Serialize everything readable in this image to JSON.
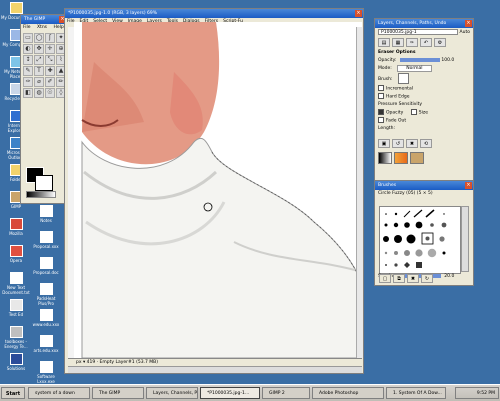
{
  "desktop": {
    "icons_left": [
      {
        "label": "My Documents",
        "icon": "folder-docs-icon"
      },
      {
        "label": "My Computer",
        "icon": "computer-icon"
      },
      {
        "label": "My Network Places",
        "icon": "network-icon"
      },
      {
        "label": "Recycle Bin",
        "icon": "recycle-bin-icon"
      },
      {
        "label": "Internet Explorer",
        "icon": "ie-icon"
      },
      {
        "label": "Microsoft Outlook",
        "icon": "outlook-icon"
      },
      {
        "label": "Folder",
        "icon": "folder-icon"
      },
      {
        "label": "GIMP",
        "icon": "gimp-icon"
      },
      {
        "label": "Mozilla",
        "icon": "mozilla-icon"
      },
      {
        "label": "Opera",
        "icon": "opera-icon"
      },
      {
        "label": "New Text Document.txt",
        "icon": "text-doc-icon"
      },
      {
        "label": "Test Ed",
        "icon": "app-icon"
      },
      {
        "label": "toolboxes - Energy Te...",
        "icon": "app-icon"
      },
      {
        "label": "Solutions",
        "icon": "solutions-icon"
      }
    ],
    "icons_right": [
      {
        "label": "Notes",
        "icon": "doc-icon"
      },
      {
        "label": "Proposal.xxx",
        "icon": "doc-icon"
      },
      {
        "label": "Proposal.doc",
        "icon": "doc-icon"
      },
      {
        "label": "PadsHeat Plus/Pro",
        "icon": "doc-icon"
      },
      {
        "label": "www.edu.xxx",
        "icon": "doc-icon"
      },
      {
        "label": "arts.edu.xxx",
        "icon": "doc-icon"
      },
      {
        "label": "Software Lxxx.exe",
        "icon": "doc-icon"
      }
    ]
  },
  "toolbox": {
    "title": "The GIMP",
    "menu": [
      "File",
      "Xtns",
      "Help"
    ],
    "tools": [
      "▭",
      "◯",
      "ʃ",
      "✦",
      "◐",
      "✥",
      "✛",
      "⊕",
      "↕",
      "⤢",
      "⤡",
      "⌇",
      "✎",
      "T",
      "✚",
      "▲",
      "✑",
      "⌀",
      "✐",
      "✏",
      "◧",
      "◍",
      "☉",
      "◊"
    ]
  },
  "image_window": {
    "title": "*P1000035.jpg-1.0 (RGB, 3 layers) 69%",
    "menu": [
      "File",
      "Edit",
      "Select",
      "View",
      "Image",
      "Layers",
      "Tools",
      "Dialogs",
      "Filters",
      "Script-Fu"
    ],
    "status": "px ▾ 419 · Empty Layer#1 (53.7 MB)",
    "zoom": "69%"
  },
  "dock": {
    "title": "Layers, Channels, Paths, Undo",
    "image_select": "P1000035.jpg-1",
    "auto_label": "Auto",
    "tool_options_header": "Eraser Options",
    "opacity_label": "Opacity:",
    "opacity_value": "100.0",
    "mode_label": "Mode:",
    "mode_value": "Normal",
    "brush_label": "Brush:",
    "incremental_label": "Incremental",
    "hard_edge_label": "Hard Edge",
    "pressure_header": "Pressure Sensitivity",
    "pressure_opacity_label": "Opacity",
    "pressure_size_label": "Size",
    "fade_out_label": "Fade Out",
    "length_label": "Length:",
    "brushes_title": "Brushes",
    "brush_name": "Circle Fuzzy (05) (5 × 5)",
    "spacing_label": "Spacing:",
    "spacing_value": "20.0"
  },
  "taskbar": {
    "start": "Start",
    "tasks": [
      {
        "label": "system of a down",
        "active": false
      },
      {
        "label": "The GIMP",
        "active": false
      },
      {
        "label": "Layers, Channels, P...",
        "active": false
      },
      {
        "label": "*P1000035.jpg-1...",
        "active": true
      },
      {
        "label": "GIMP 2",
        "active": false
      },
      {
        "label": "Adobe Photoshop",
        "active": false
      },
      {
        "label": "1. System Of A Dow...",
        "active": false
      }
    ],
    "clock": "9:52 PM"
  },
  "colors": {
    "desktop": "#3a6ea5",
    "titlebar": "#1b5cc4",
    "skin": "#e08a78",
    "shirt": "#f5f5f3"
  }
}
